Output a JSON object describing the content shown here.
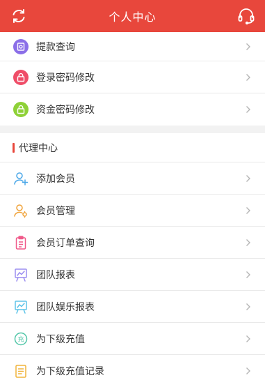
{
  "header": {
    "title": "个人中心",
    "left_icon": "refresh-icon",
    "right_icon": "headset-icon",
    "color": "#e8473c"
  },
  "account_items": [
    {
      "label": "提款查询",
      "icon": "withdraw-query-icon",
      "color": "#8b6fe8"
    },
    {
      "label": "登录密码修改",
      "icon": "lock-icon",
      "color": "#ef4d68"
    },
    {
      "label": "资金密码修改",
      "icon": "lock-icon",
      "color": "#8ed137"
    }
  ],
  "agent_section": {
    "title": "代理中心",
    "items": [
      {
        "label": "添加会员",
        "icon": "add-user-icon",
        "color": "#4aa7e8"
      },
      {
        "label": "会员管理",
        "icon": "user-manage-icon",
        "color": "#f0a33a"
      },
      {
        "label": "会员订单查询",
        "icon": "clipboard-icon",
        "color": "#f05a8a"
      },
      {
        "label": "团队报表",
        "icon": "chart-board-icon",
        "color": "#9b8ef0"
      },
      {
        "label": "团队娱乐报表",
        "icon": "chart-board-icon",
        "color": "#5ec4e8"
      },
      {
        "label": "为下级充值",
        "icon": "recharge-icon",
        "color": "#52c6a8"
      },
      {
        "label": "为下级充值记录",
        "icon": "record-list-icon",
        "color": "#f0b33a"
      }
    ]
  }
}
